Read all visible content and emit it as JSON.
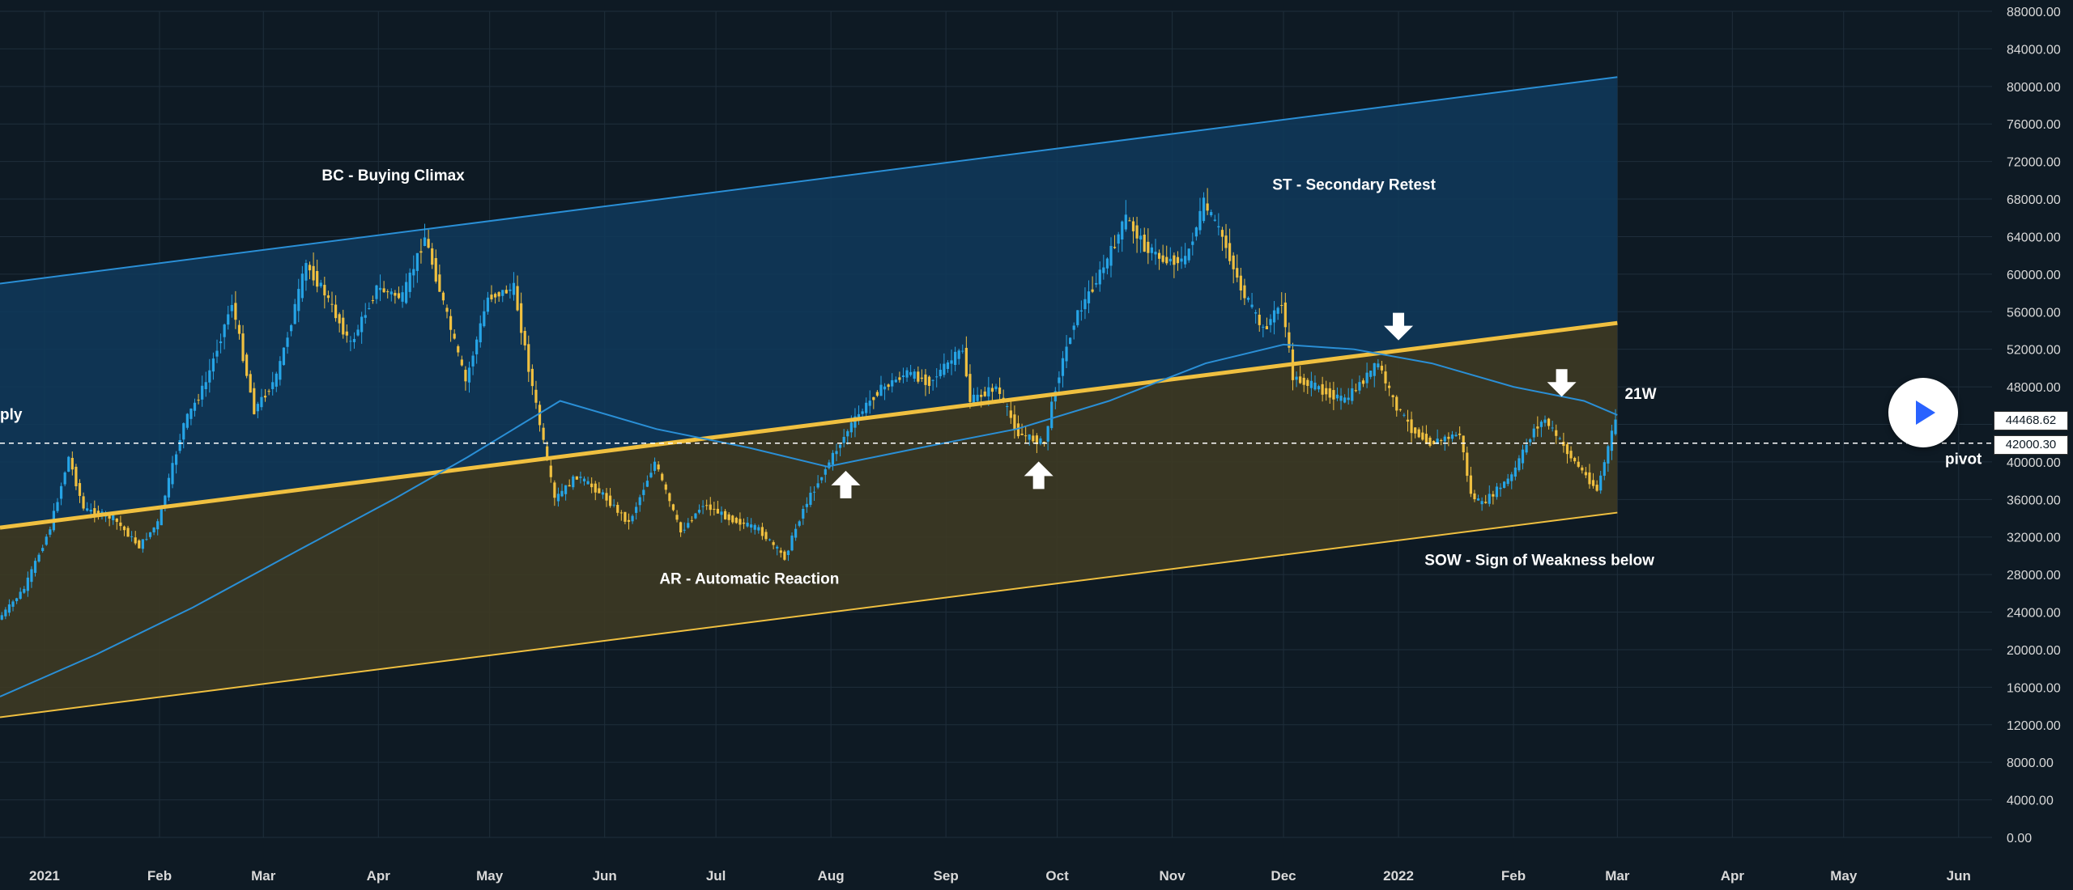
{
  "chart_data": {
    "type": "candlestick",
    "title": "",
    "xlabel": "",
    "ylabel": "",
    "ylim": [
      0,
      88000
    ],
    "xlim": [
      "2020-12-20",
      "2022-06-10"
    ],
    "y_ticks": [
      0,
      4000,
      8000,
      12000,
      16000,
      20000,
      24000,
      28000,
      32000,
      36000,
      40000,
      44000,
      48000,
      52000,
      56000,
      60000,
      64000,
      68000,
      72000,
      76000,
      80000,
      84000,
      88000
    ],
    "y_tick_labels": [
      "0.00",
      "4000.00",
      "8000.00",
      "12000.00",
      "16000.00",
      "20000.00",
      "24000.00",
      "28000.00",
      "32000.00",
      "36000.00",
      "40000.00",
      "44000.00",
      "48000.00",
      "52000.00",
      "56000.00",
      "60000.00",
      "64000.00",
      "68000.00",
      "72000.00",
      "76000.00",
      "80000.00",
      "84000.00",
      "88000.00"
    ],
    "x_ticks": [
      {
        "date": "2021-01-01",
        "label": "2021"
      },
      {
        "date": "2021-02-01",
        "label": "Feb"
      },
      {
        "date": "2021-03-01",
        "label": "Mar"
      },
      {
        "date": "2021-04-01",
        "label": "Apr"
      },
      {
        "date": "2021-05-01",
        "label": "May"
      },
      {
        "date": "2021-06-01",
        "label": "Jun"
      },
      {
        "date": "2021-07-01",
        "label": "Jul"
      },
      {
        "date": "2021-08-01",
        "label": "Aug"
      },
      {
        "date": "2021-09-01",
        "label": "Sep"
      },
      {
        "date": "2021-10-01",
        "label": "Oct"
      },
      {
        "date": "2021-11-01",
        "label": "Nov"
      },
      {
        "date": "2021-12-01",
        "label": "Dec"
      },
      {
        "date": "2022-01-01",
        "label": "2022"
      },
      {
        "date": "2022-02-01",
        "label": "Feb"
      },
      {
        "date": "2022-03-01",
        "label": "Mar"
      },
      {
        "date": "2022-04-01",
        "label": "Apr"
      },
      {
        "date": "2022-05-01",
        "label": "May"
      },
      {
        "date": "2022-06-01",
        "label": "Jun"
      }
    ],
    "price_path": [
      [
        "2020-12-20",
        23200
      ],
      [
        "2020-12-27",
        26500
      ],
      [
        "2021-01-03",
        33000
      ],
      [
        "2021-01-08",
        40500
      ],
      [
        "2021-01-12",
        35000
      ],
      [
        "2021-01-20",
        34000
      ],
      [
        "2021-01-27",
        31000
      ],
      [
        "2021-02-01",
        33500
      ],
      [
        "2021-02-08",
        44000
      ],
      [
        "2021-02-14",
        48500
      ],
      [
        "2021-02-21",
        57000
      ],
      [
        "2021-02-27",
        45500
      ],
      [
        "2021-03-05",
        49000
      ],
      [
        "2021-03-13",
        61000
      ],
      [
        "2021-03-18",
        58000
      ],
      [
        "2021-03-25",
        52500
      ],
      [
        "2021-04-01",
        58500
      ],
      [
        "2021-04-08",
        57500
      ],
      [
        "2021-04-14",
        64000
      ],
      [
        "2021-04-20",
        55500
      ],
      [
        "2021-04-25",
        48500
      ],
      [
        "2021-05-01",
        57500
      ],
      [
        "2021-05-08",
        58500
      ],
      [
        "2021-05-12",
        50000
      ],
      [
        "2021-05-19",
        36000
      ],
      [
        "2021-05-25",
        38500
      ],
      [
        "2021-06-01",
        36500
      ],
      [
        "2021-06-08",
        33500
      ],
      [
        "2021-06-15",
        40000
      ],
      [
        "2021-06-22",
        32500
      ],
      [
        "2021-06-28",
        35500
      ],
      [
        "2021-07-05",
        34000
      ],
      [
        "2021-07-13",
        32800
      ],
      [
        "2021-07-20",
        29800
      ],
      [
        "2021-07-25",
        35000
      ],
      [
        "2021-08-01",
        40000
      ],
      [
        "2021-08-07",
        44000
      ],
      [
        "2021-08-14",
        47500
      ],
      [
        "2021-08-22",
        49500
      ],
      [
        "2021-08-28",
        48500
      ],
      [
        "2021-09-06",
        52000
      ],
      [
        "2021-09-08",
        46500
      ],
      [
        "2021-09-15",
        48000
      ],
      [
        "2021-09-21",
        43000
      ],
      [
        "2021-09-28",
        42000
      ],
      [
        "2021-10-01",
        48000
      ],
      [
        "2021-10-06",
        55000
      ],
      [
        "2021-10-15",
        61500
      ],
      [
        "2021-10-20",
        66000
      ],
      [
        "2021-10-25",
        63000
      ],
      [
        "2021-10-30",
        61500
      ],
      [
        "2021-11-05",
        61500
      ],
      [
        "2021-11-10",
        67500
      ],
      [
        "2021-11-15",
        64000
      ],
      [
        "2021-11-20",
        58500
      ],
      [
        "2021-11-26",
        54000
      ],
      [
        "2021-12-01",
        57000
      ],
      [
        "2021-12-04",
        49000
      ],
      [
        "2021-12-10",
        48000
      ],
      [
        "2021-12-18",
        46500
      ],
      [
        "2021-12-27",
        50500
      ],
      [
        "2021-12-31",
        46500
      ],
      [
        "2022-01-05",
        43500
      ],
      [
        "2022-01-10",
        42000
      ],
      [
        "2022-01-18",
        43000
      ],
      [
        "2022-01-21",
        36500
      ],
      [
        "2022-01-24",
        35500
      ],
      [
        "2022-02-01",
        38500
      ],
      [
        "2022-02-07",
        43500
      ],
      [
        "2022-02-10",
        44500
      ],
      [
        "2022-02-17",
        40500
      ],
      [
        "2022-02-24",
        37000
      ],
      [
        "2022-02-28",
        43000
      ],
      [
        "2022-03-01",
        44468
      ]
    ],
    "series": [
      {
        "name": "21W",
        "type": "line",
        "color": "#2a8fd6",
        "values": [
          [
            "2020-12-20",
            15000
          ],
          [
            "2021-01-15",
            19500
          ],
          [
            "2021-02-10",
            24500
          ],
          [
            "2021-03-10",
            30500
          ],
          [
            "2021-04-05",
            36000
          ],
          [
            "2021-04-25",
            40500
          ],
          [
            "2021-05-20",
            46500
          ],
          [
            "2021-06-15",
            43500
          ],
          [
            "2021-07-10",
            41500
          ],
          [
            "2021-07-31",
            39500
          ],
          [
            "2021-08-25",
            41500
          ],
          [
            "2021-09-20",
            43500
          ],
          [
            "2021-10-15",
            46500
          ],
          [
            "2021-11-10",
            50500
          ],
          [
            "2021-12-01",
            52500
          ],
          [
            "2021-12-20",
            52000
          ],
          [
            "2022-01-10",
            50500
          ],
          [
            "2022-02-01",
            48000
          ],
          [
            "2022-02-20",
            46500
          ],
          [
            "2022-03-01",
            45000
          ]
        ]
      }
    ],
    "channel": {
      "upper_line": {
        "start": [
          "2020-12-20",
          59000
        ],
        "end": [
          "2022-03-01",
          81000
        ],
        "color": "#2a8fd6"
      },
      "mid_line": {
        "start": [
          "2020-12-20",
          33000
        ],
        "end": [
          "2022-03-01",
          54800
        ],
        "color": "#f0c040"
      },
      "lower_line": {
        "start": [
          "2020-12-20",
          12800
        ],
        "end": [
          "2022-03-01",
          34600
        ],
        "color": "#f0c040"
      },
      "upper_fill_color": "#0f3a5c",
      "lower_fill_color": "#3d3a24"
    },
    "pivot_level": 42000.3,
    "last_price": 44468.62,
    "annotations": {
      "bc": {
        "text": "BC - Buying Climax",
        "date": "2021-04-05",
        "price": 70000
      },
      "ar": {
        "text": "AR - Automatic Reaction",
        "date": "2021-07-10",
        "price": 27000
      },
      "st": {
        "text": "ST - Secondary Retest",
        "date": "2021-11-28",
        "price": 69000
      },
      "sow": {
        "text": "SOW - Sign of Weakness below",
        "date": "2022-02-08",
        "price": 29000
      },
      "supply": {
        "text": "ply",
        "date": "2020-12-20",
        "price": 44500
      },
      "ma_label": {
        "text": "21W",
        "date": "2022-03-03",
        "price": 46700
      }
    },
    "arrows": [
      {
        "direction": "up",
        "date": "2021-08-05",
        "price": 37500
      },
      {
        "direction": "up",
        "date": "2021-09-26",
        "price": 38500
      },
      {
        "direction": "down",
        "date": "2022-01-01",
        "price": 54500
      },
      {
        "direction": "down",
        "date": "2022-02-14",
        "price": 48500
      }
    ],
    "price_tags": {
      "last": {
        "text": "44468.62",
        "price": 44468.62
      },
      "pivot": {
        "text": "42000.30",
        "price": 42000.3
      },
      "pivot_label": "pivot"
    },
    "grid": true,
    "colors": {
      "background": "#0e1a24",
      "candle_up": "#26a4e6",
      "candle_down": "#f0c040",
      "grid": "#1f2e3b",
      "text": "#d9d9d9"
    }
  },
  "ui": {
    "play_button_icon": "play-icon"
  }
}
